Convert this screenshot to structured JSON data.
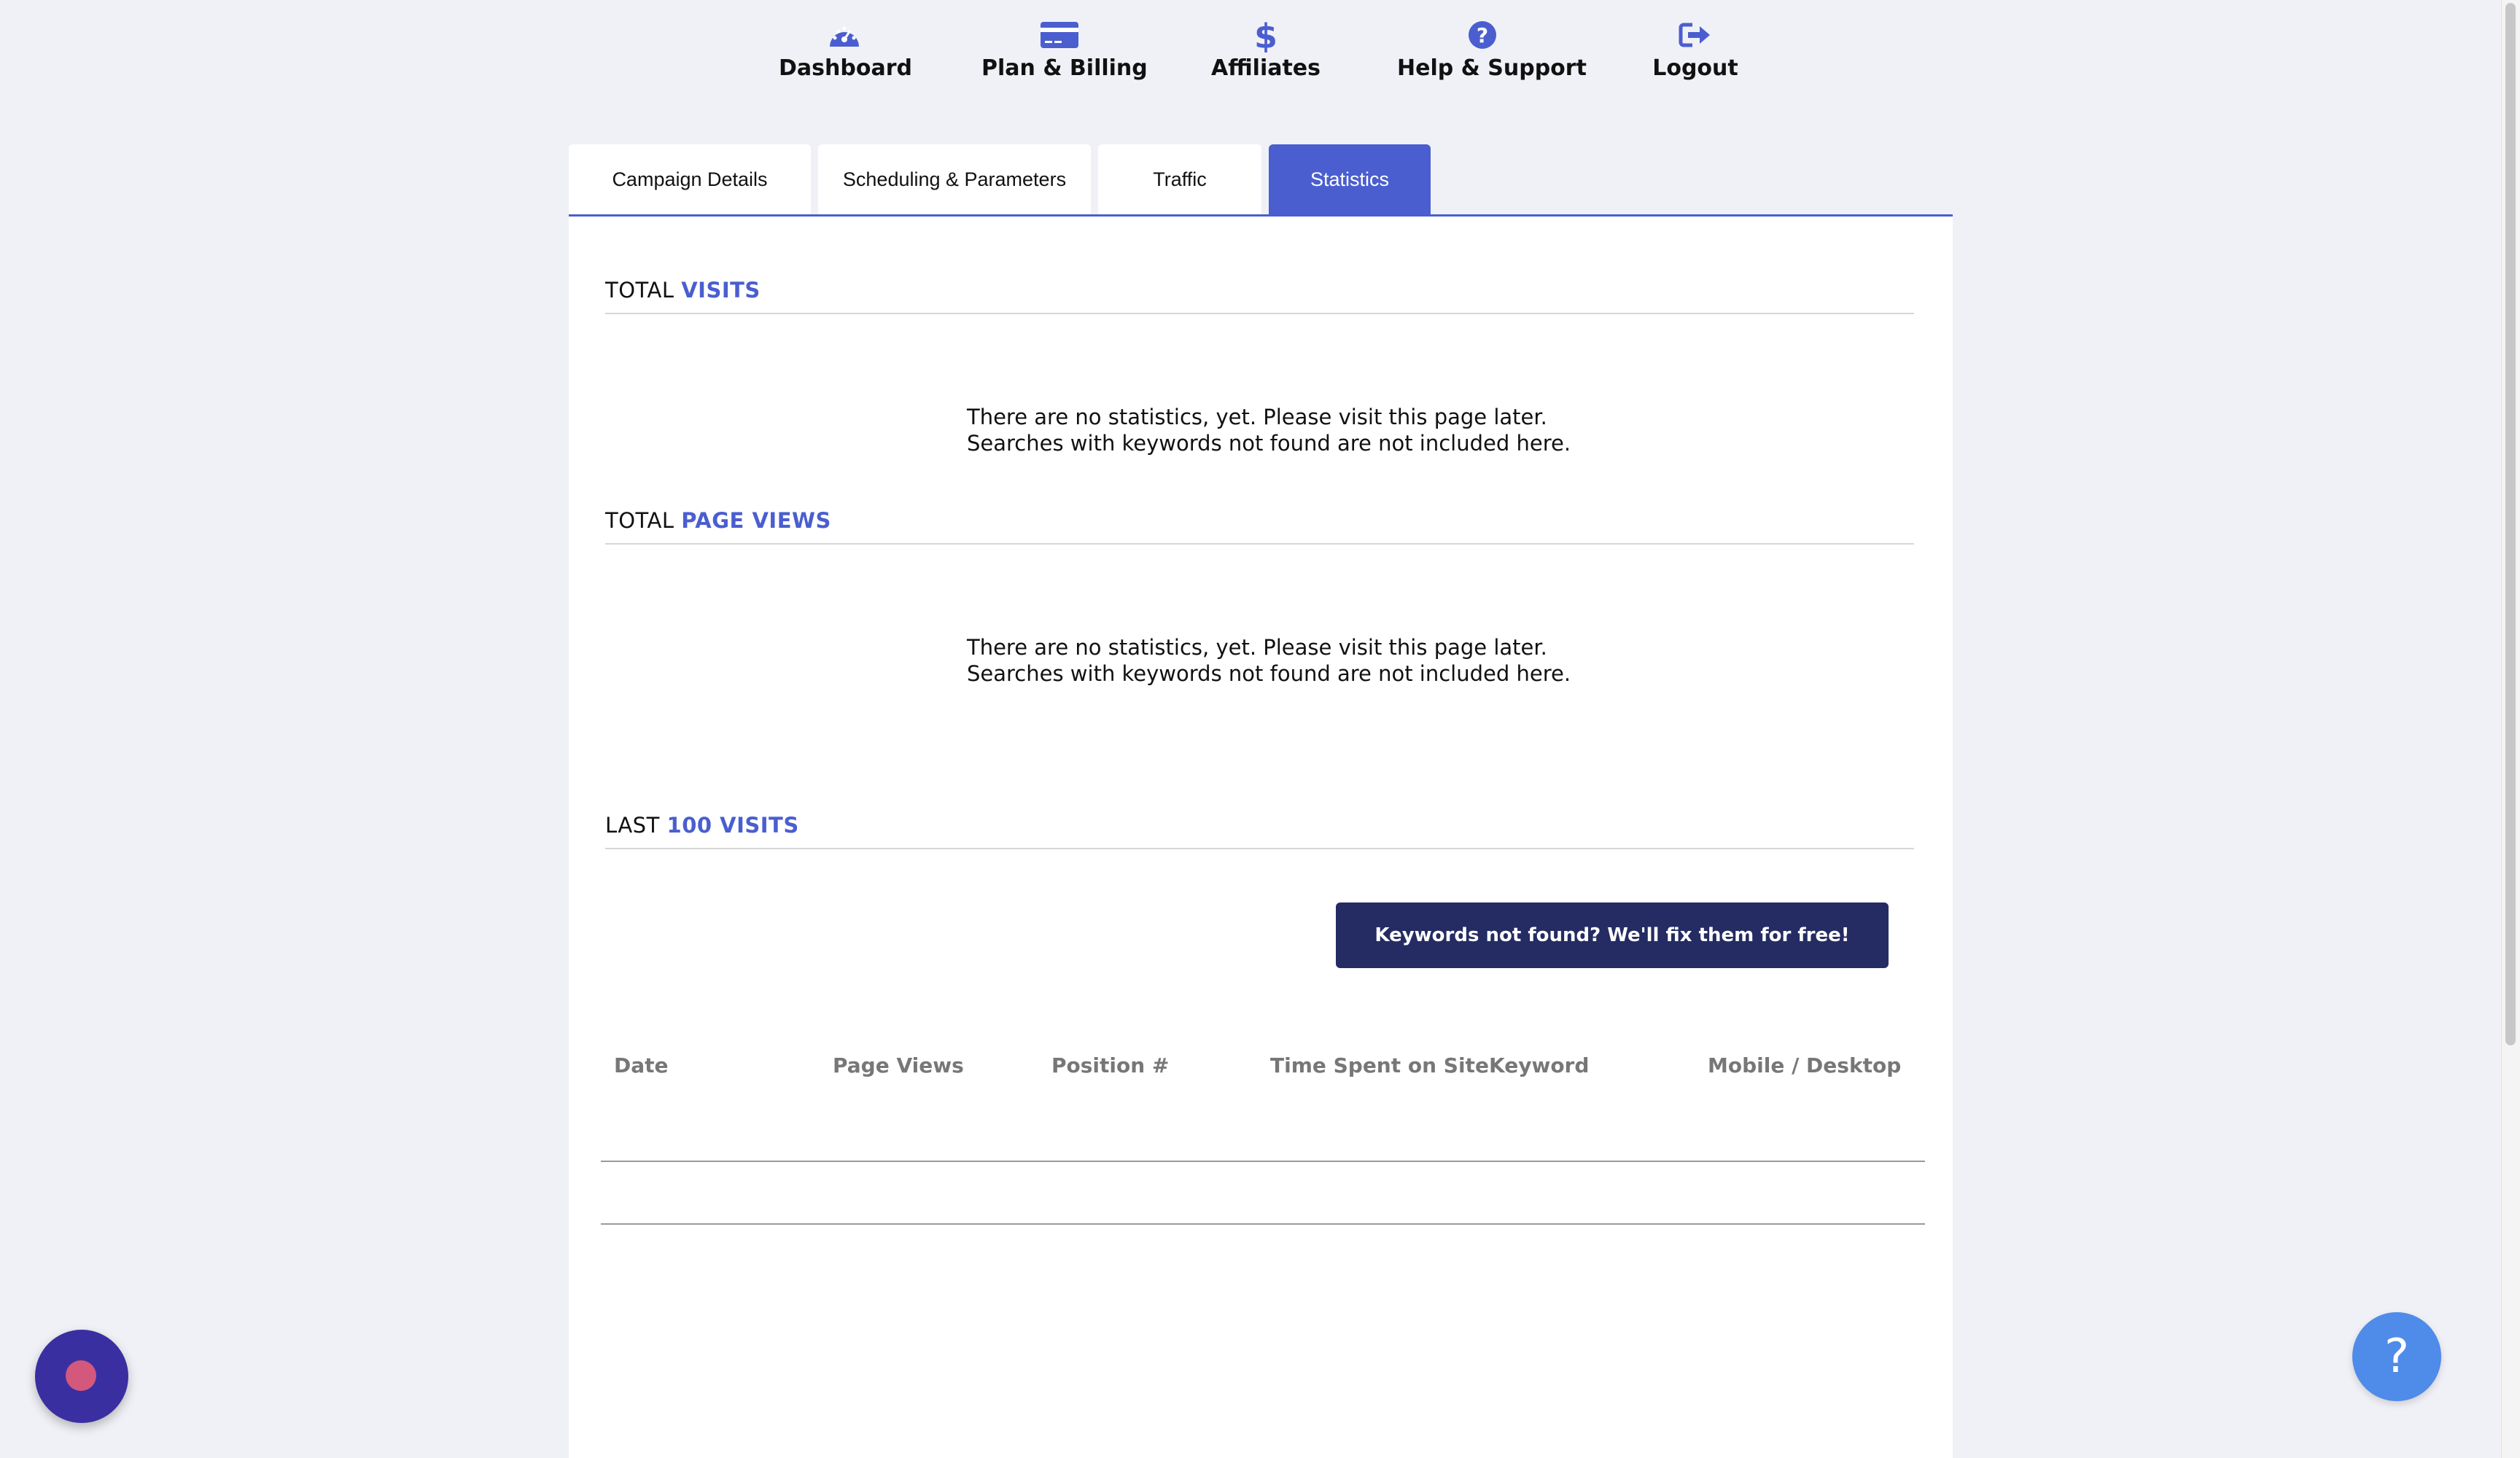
{
  "nav": {
    "items": [
      {
        "label": "Dashboard",
        "icon": "dashboard-gauge-icon"
      },
      {
        "label": "Plan & Billing",
        "icon": "credit-card-icon"
      },
      {
        "label": "Affiliates",
        "icon": "dollar-icon"
      },
      {
        "label": "Help & Support",
        "icon": "question-circle-icon"
      },
      {
        "label": "Logout",
        "icon": "logout-icon"
      }
    ],
    "icon_color": "#4a5ed0"
  },
  "tabs": [
    {
      "label": "Campaign Details",
      "active": false
    },
    {
      "label": "Scheduling & Parameters",
      "active": false
    },
    {
      "label": "Traffic",
      "active": false
    },
    {
      "label": "Statistics",
      "active": true
    }
  ],
  "sections": {
    "visits": {
      "prefix": "TOTAL",
      "accent": "VISITS"
    },
    "pageviews": {
      "prefix": "TOTAL",
      "accent": "PAGE VIEWS"
    },
    "last": {
      "prefix": "LAST",
      "accent": "100 VISITS"
    }
  },
  "empty_message": {
    "line1": "There are no statistics, yet. Please visit this page later.",
    "line2": "Searches with keywords not found are not included here."
  },
  "cta_label": "Keywords not found? We'll fix them for free!",
  "table": {
    "columns": [
      "Date",
      "Page Views",
      "Position #",
      "Time Spent on Site",
      "Keyword",
      "Mobile / Desktop"
    ]
  },
  "help_button_label": "?",
  "colors": {
    "accent": "#4a5ed0",
    "cta_bg": "#252c63",
    "page_bg": "#f0f1f6",
    "chat_bg": "#3a2fa0",
    "help_bg": "#4f8be9"
  }
}
